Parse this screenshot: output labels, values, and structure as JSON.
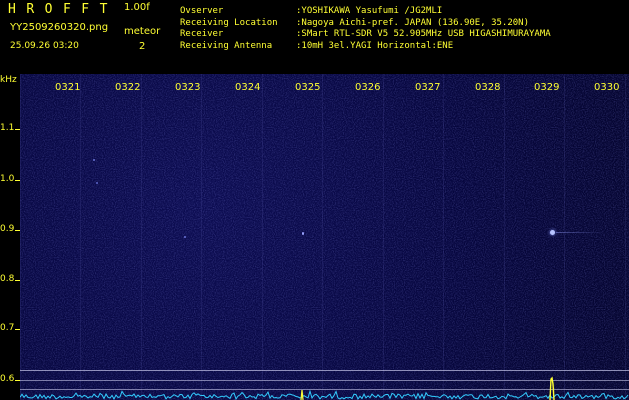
{
  "header": {
    "brand": "HROFFT",
    "version": "1.00f",
    "filename": "YY2509260320.png",
    "timestamp": "25.09.26 03:20",
    "meteor_label": "meteor",
    "meteor_count": "2",
    "info": [
      {
        "key": "Ovserver",
        "value": ":YOSHIKAWA Yasufumi /JG2MLI"
      },
      {
        "key": "Receiving Location",
        "value": ":Nagoya Aichi-pref. JAPAN (136.90E, 35.20N)"
      },
      {
        "key": "Receiver",
        "value": ":SMart RTL-SDR V5 52.905MHz USB HIGASHIMURAYAMA"
      },
      {
        "key": "Receiving Antenna",
        "value": ":10mH 3el.YAGI Horizontal:ENE"
      }
    ]
  },
  "axis": {
    "unit": "kHz",
    "y_labels": [
      "1.1",
      "1.0",
      "0.9",
      "0.8",
      "0.7",
      "0.6"
    ],
    "time_labels": [
      "0321",
      "0322",
      "0323",
      "0324",
      "0325",
      "0326",
      "0327",
      "0328",
      "0329",
      "0330"
    ]
  },
  "colors": {
    "text": "#ffff33",
    "background": "#000000",
    "plot": "#06063e",
    "spectrum": "#33ccff",
    "echo": "#aab8ff"
  }
}
